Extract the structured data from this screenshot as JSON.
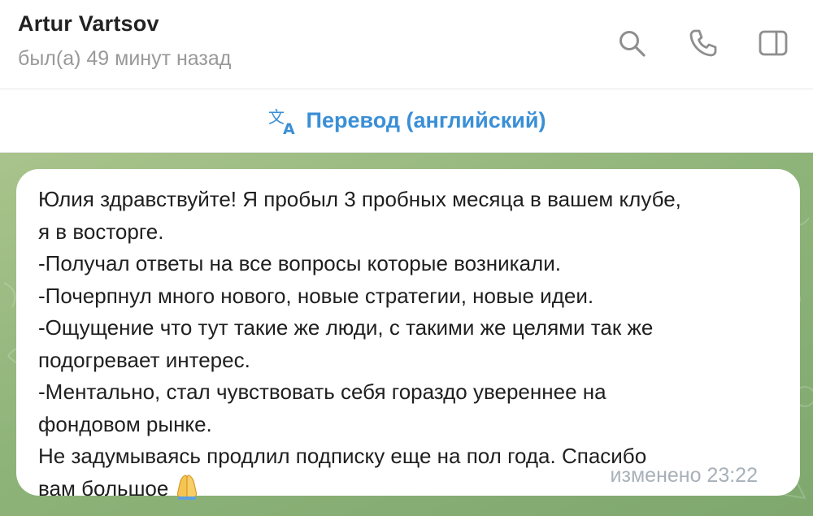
{
  "header": {
    "name": "Artur Vartsov",
    "status": "был(а) 49 минут назад",
    "icons": [
      "search-icon",
      "phone-icon",
      "sidebar-toggle-icon"
    ]
  },
  "translate": {
    "label": "Перевод (английский)",
    "icon": "translate-icon",
    "color": "#3a8fd6"
  },
  "message": {
    "lines": [
      "Юлия здравствуйте! Я пробыл 3 пробных месяца в вашем клубе,",
      "я в восторге.",
      "-Получал ответы на все вопросы которые возникали.",
      "-Почерпнул много нового, новые стратегии, новые идеи.",
      "-Ощущение что тут такие же люди, с такими же целями так же",
      "подогревает интерес.",
      "-Ментально, стал чувствовать себя гораздо увереннее на",
      "фондовом рынке.",
      "Не задумываясь продлил подписку еще на пол года. Спасибо",
      "вам большое"
    ],
    "emoji": "folded-hands",
    "meta": "изменено 23:22"
  },
  "colors": {
    "chat_background": "#8fb47a",
    "bubble": "#ffffff",
    "accent": "#3a8fd6"
  }
}
